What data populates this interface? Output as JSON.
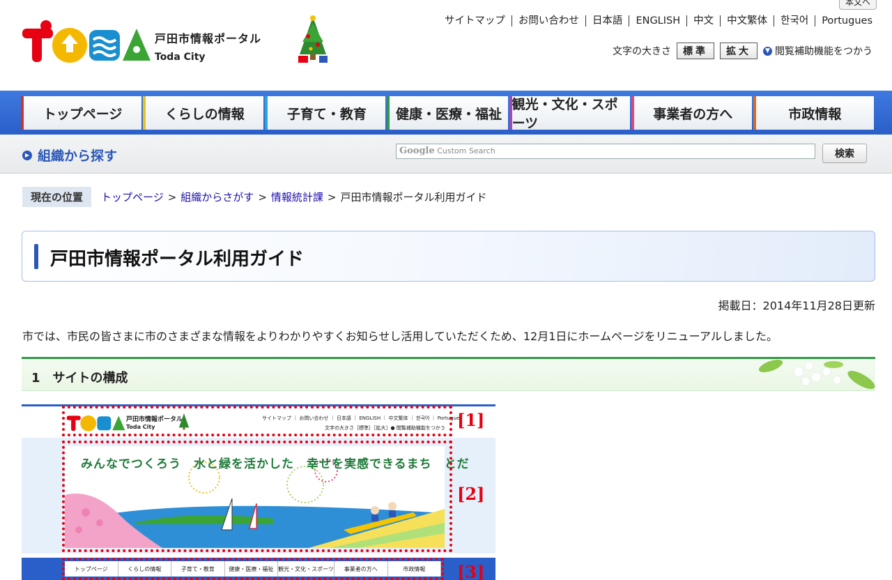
{
  "header": {
    "skip_label": "本文へ",
    "site_name_jp": "戸田市情報ポータル",
    "site_name_en": "Toda City",
    "top_links": [
      "サイトマップ",
      "お問い合わせ",
      "日本語",
      "ENGLISH",
      "中文",
      "中文繁体",
      "한국어",
      "Portugues"
    ],
    "font_size_label": "文字の大きさ",
    "font_normal": "標準",
    "font_large": "拡大",
    "assist_label": "閲覧補助機能をつかう"
  },
  "nav": {
    "items": [
      {
        "label": "トップページ",
        "color": "#cc3333"
      },
      {
        "label": "くらしの情報",
        "color": "#e8c21a"
      },
      {
        "label": "子育て・教育",
        "color": "#2aa6d6"
      },
      {
        "label": "健康・医療・福祉",
        "color": "#2f9a44"
      },
      {
        "label": "観光・文化・スポーツ",
        "color": "#a34bb5"
      },
      {
        "label": "事業者の方へ",
        "color": "#e0467c"
      },
      {
        "label": "市政情報",
        "color": "#e06a1a"
      }
    ]
  },
  "subbar": {
    "org_search": "組織から探す",
    "search_placeholder": "Custom Search",
    "search_brand": "Google",
    "search_button": "検索"
  },
  "breadcrumb": {
    "label": "現在の位置",
    "items": [
      "トップページ",
      "組織からさがす",
      "情報統計課"
    ],
    "current": "戸田市情報ポータル利用ガイド"
  },
  "main": {
    "title": "戸田市情報ポータル利用ガイド",
    "updated": "掲載日：2014年11月28日更新",
    "intro": "市では、市民の皆さまに市のさまざまな情報をよりわかりやすくお知らせし活用していただくため、12月1日にホームページをリニューアルしました。",
    "section1": "1　サイトの構成"
  },
  "preview": {
    "site_name_jp": "戸田市情報ポータル",
    "site_name_en": "Toda City",
    "links": "サイトマップ ｜ お問い合わせ ｜ 日本語 ｜ ENGLISH ｜ 中文繁体 ｜ 한국어 ｜ Portugues",
    "font_row": "文字の大きさ［標準］［拡大］● 閲覧補助機能をつかう",
    "slogan": "みんなでつくろう　水と緑を活かした　幸せを実感できるまち　とだ",
    "nav": [
      "トップページ",
      "くらしの情報",
      "子育て・教育",
      "健康・医療・福祉",
      "観光・文化・スポーツ",
      "事業者の方へ",
      "市政情報"
    ],
    "tags": [
      "[1]",
      "[2]",
      "[3]"
    ]
  }
}
